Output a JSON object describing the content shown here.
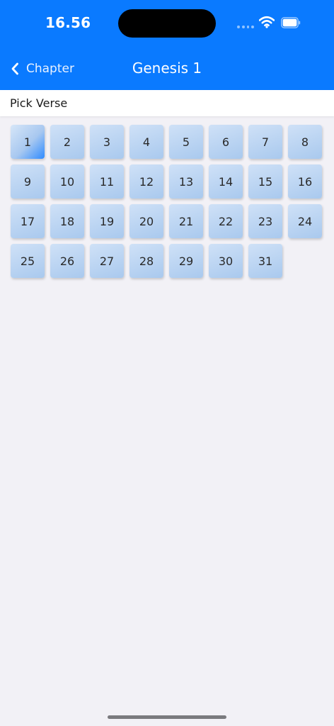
{
  "status": {
    "time": "16.56"
  },
  "nav": {
    "back_label": "Chapter",
    "title": "Genesis 1"
  },
  "section": {
    "title": "Pick Verse"
  },
  "verses": {
    "items": [
      "1",
      "2",
      "3",
      "4",
      "5",
      "6",
      "7",
      "8",
      "9",
      "10",
      "11",
      "12",
      "13",
      "14",
      "15",
      "16",
      "17",
      "18",
      "19",
      "20",
      "21",
      "22",
      "23",
      "24",
      "25",
      "26",
      "27",
      "28",
      "29",
      "30",
      "31"
    ],
    "selected": "1"
  },
  "colors": {
    "header": "#0a7aff",
    "background": "#f2f1f6",
    "tile_light": "#cfe1f7",
    "tile_dark": "#a9c9ee",
    "tile_selected_accent": "#2f8bff"
  },
  "icons": {
    "back": "chevron-left-icon",
    "wifi": "wifi-icon",
    "battery": "battery-icon",
    "signal": "signal-icon"
  }
}
